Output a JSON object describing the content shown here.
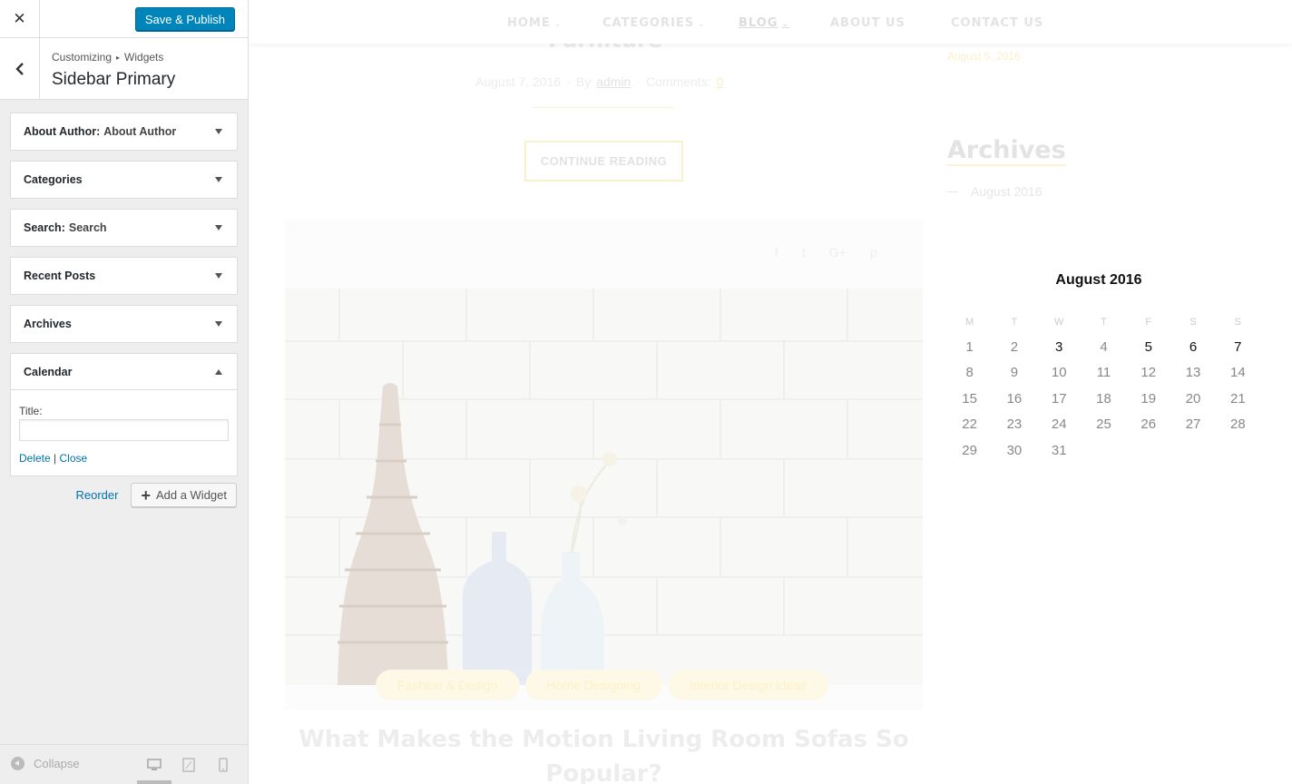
{
  "customizer": {
    "close_label": "✕",
    "publish_label": "Save & Publish",
    "breadcrumb": {
      "part1": "Customizing",
      "separator": "▸",
      "part2": "Widgets"
    },
    "section_title": "Sidebar Primary",
    "widgets": [
      {
        "name": "About Author:",
        "title": "About Author"
      },
      {
        "name": "Categories",
        "title": ""
      },
      {
        "name": "Search:",
        "title": "Search"
      },
      {
        "name": "Recent Posts",
        "title": ""
      },
      {
        "name": "Archives",
        "title": ""
      },
      {
        "name": "Calendar",
        "title": ""
      }
    ],
    "calendar_form": {
      "title_label": "Title:",
      "title_value": "",
      "delete_label": "Delete",
      "separator": "|",
      "close_label": "Close"
    },
    "reorder_label": "Reorder",
    "add_widget_label": "Add a Widget",
    "collapse_label": "Collapse",
    "devices": [
      "desktop-icon",
      "tablet-icon",
      "mobile-icon"
    ]
  },
  "preview": {
    "nav": [
      {
        "label": "HOME",
        "has_dropdown": true
      },
      {
        "label": "CATEGORIES",
        "has_dropdown": true
      },
      {
        "label": "BLOG",
        "has_dropdown": true
      },
      {
        "label": "ABOUT US",
        "has_dropdown": false
      },
      {
        "label": "CONTACT US",
        "has_dropdown": false
      }
    ],
    "post1": {
      "title": "Furniture",
      "date": "August 7, 2016",
      "by": "By",
      "author": "admin",
      "comments_label": "Comments:",
      "comments_count": "0",
      "continue_label": "CONTINUE READING"
    },
    "share_icons": [
      "f",
      "t",
      "G+",
      "p"
    ],
    "post2": {
      "tags": [
        "Fashion & Design",
        "Home Designing",
        "Interior Design Ideas"
      ],
      "title": "What Makes the Motion Living Room Sofas So Popular?"
    },
    "sidebar": {
      "recent_date": "August 5, 2016",
      "archives_heading": "Archives",
      "archive_item": "August 2016"
    },
    "calendar": {
      "caption": "August 2016",
      "weekdays": [
        "M",
        "T",
        "W",
        "T",
        "F",
        "S",
        "S"
      ],
      "weeks": [
        [
          "1",
          "2",
          "3",
          "4",
          "5",
          "6",
          "7"
        ],
        [
          "8",
          "9",
          "10",
          "11",
          "12",
          "13",
          "14"
        ],
        [
          "15",
          "16",
          "17",
          "18",
          "19",
          "20",
          "21"
        ],
        [
          "22",
          "23",
          "24",
          "25",
          "26",
          "27",
          "28"
        ],
        [
          "29",
          "30",
          "31",
          "",
          "",
          "",
          ""
        ]
      ],
      "linked_days": [
        "3",
        "5",
        "6",
        "7"
      ]
    },
    "colors": {
      "accent": "#0085ba",
      "link": "#0073aa",
      "highlight": "#fdf0c9"
    }
  }
}
